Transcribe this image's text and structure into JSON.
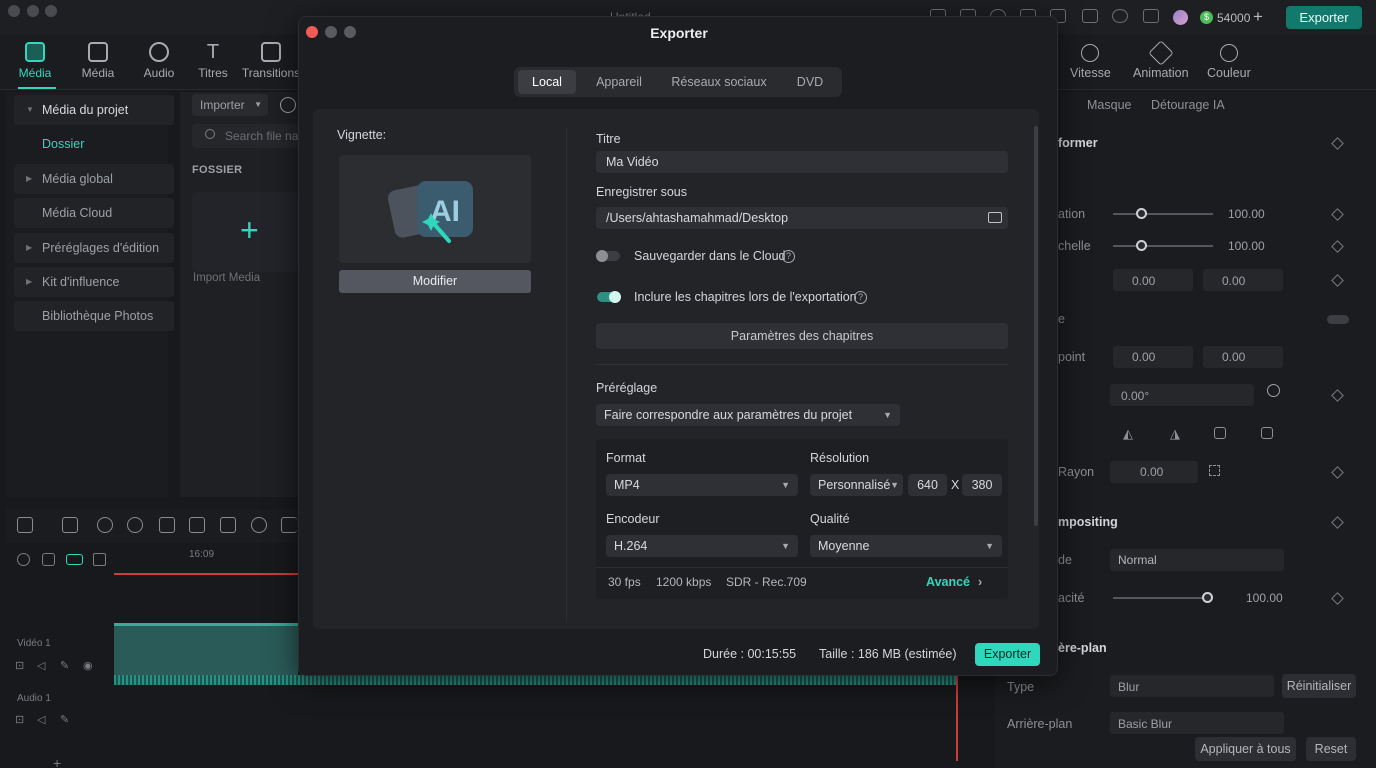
{
  "app": {
    "title": "Untitled",
    "credits": "54000",
    "credits_add": "+",
    "export_label": "Exporter",
    "accent_color": "#2fd7bd"
  },
  "toolbar": {
    "items": [
      {
        "label": "Média",
        "icon": "media-icon",
        "active": true
      },
      {
        "label": "Média",
        "icon": "stock-media-icon"
      },
      {
        "label": "Audio",
        "icon": "audio-icon"
      },
      {
        "label": "Titres",
        "icon": "titles-icon"
      },
      {
        "label": "Transitions",
        "icon": "transitions-icon"
      }
    ]
  },
  "sidebar": {
    "items": [
      {
        "label": "Média du projet"
      },
      {
        "label": "Dossier"
      },
      {
        "label": "Média global"
      },
      {
        "label": "Média Cloud"
      },
      {
        "label": "Préréglages d'édition"
      },
      {
        "label": "Kit d'influence"
      },
      {
        "label": "Bibliothèque Photos"
      }
    ]
  },
  "media_panel": {
    "import_label": "Importer",
    "search_placeholder": "Search file na",
    "folder_label": "FOSSIER",
    "import_media_label": "Import Media"
  },
  "right_panel": {
    "tabs": [
      {
        "label": "Vitesse",
        "icon": "speed-icon"
      },
      {
        "label": "Animation",
        "icon": "animation-icon"
      },
      {
        "label": "Couleur",
        "icon": "color-icon"
      }
    ],
    "subtabs": [
      "Masque",
      "Détourage IA"
    ],
    "transform_header": "former",
    "rows": {
      "rotation_label": "ation",
      "rotation_value": "100.00",
      "scale_label": "chelle",
      "scale_value": "100.00",
      "pos_x": "0.00",
      "pos_y": "0.00",
      "flip_label": "e",
      "anchor_label": "point",
      "anchor_x": "0.00",
      "anchor_y": "0.00",
      "angle_value": "0.00°",
      "radius_label": "Rayon",
      "radius_value": "0.00",
      "compositing_header": "mpositing",
      "blend_label": "de",
      "blend_value": "Normal",
      "opacity_label": "acité",
      "opacity_value": "100.00",
      "background_header": "ère-plan",
      "type_label": "Type",
      "type_value": "Blur",
      "reset_label": "Réinitialiser",
      "bg_label": "Arrière-plan",
      "bg_value": "Basic Blur",
      "apply_all": "Appliquer à tous",
      "reset": "Reset"
    }
  },
  "timeline": {
    "ruler_time": "16:09",
    "video_track": "Vidéo 1",
    "audio_track": "Audio 1"
  },
  "modal": {
    "title": "Exporter",
    "tabs": [
      {
        "label": "Local",
        "active": true
      },
      {
        "label": "Appareil"
      },
      {
        "label": "Réseaux sociaux"
      },
      {
        "label": "DVD"
      }
    ],
    "thumbnail_label": "Vignette:",
    "thumbnail_text": "AI",
    "modify_label": "Modifier",
    "title_label": "Titre",
    "title_value": "Ma Vidéo",
    "save_as_label": "Enregistrer sous",
    "save_path": "/Users/ahtashamahmad/Desktop",
    "cloud_toggle_label": "Sauvegarder dans le Cloud",
    "cloud_toggle_on": false,
    "chapters_toggle_label": "Inclure les chapitres lors de l'exportation",
    "chapters_toggle_on": true,
    "chapters_button": "Paramètres des chapitres",
    "preset_label": "Préréglage",
    "preset_value": "Faire correspondre aux paramètres du projet",
    "format_label": "Format",
    "format_value": "MP4",
    "resolution_label": "Résolution",
    "resolution_value": "Personnalisé",
    "res_width": "640",
    "res_x": "X",
    "res_height": "380",
    "encoder_label": "Encodeur",
    "encoder_value": "H.264",
    "quality_label": "Qualité",
    "quality_value": "Moyenne",
    "fps": "30 fps",
    "bitrate": "1200 kbps",
    "color_space": "SDR - Rec.709",
    "advanced_label": "Avancé",
    "duration": "Durée : 00:15:55",
    "size": "Taille : 186 MB (estimée)",
    "export_button": "Exporter"
  }
}
